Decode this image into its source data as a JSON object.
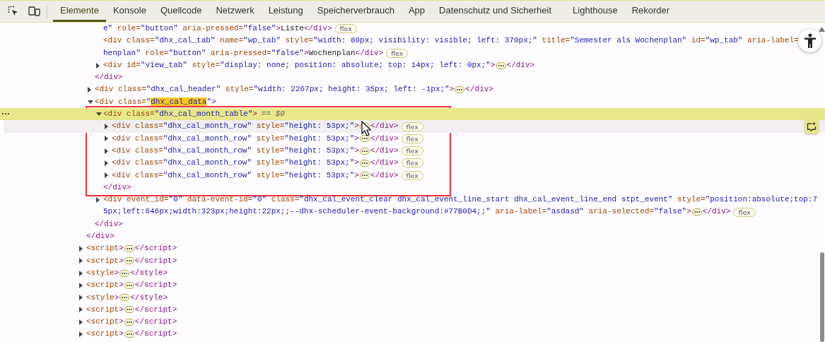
{
  "tabs": [
    {
      "label": "Elemente",
      "selected": true
    },
    {
      "label": "Konsole",
      "selected": false
    },
    {
      "label": "Quellcode",
      "selected": false
    },
    {
      "label": "Netzwerk",
      "selected": false
    },
    {
      "label": "Leistung",
      "selected": false
    },
    {
      "label": "Speicherverbrauch",
      "selected": false
    },
    {
      "label": "App",
      "selected": false
    },
    {
      "label": "Datenschutz und Sicherheit",
      "selected": false
    },
    {
      "label": "Lighthouse",
      "selected": false
    },
    {
      "label": "Rekorder",
      "selected": false
    }
  ],
  "dom": [
    {
      "close": "</div>",
      "children": [
        {
          "close": "</div>",
          "children": [
            {
              "lines": [
                "e\" role=\"button\" aria-pressed=\"false\">Liste</div>"
              ],
              "badge": "flex",
              "selected": false
            },
            {
              "lines": [
                "<div class=\"dhx_cal_tab\" name=\"wp_tab\" style=\"width: 80px; visibility: visible; left: 370px;\" title=\"Semester als Wochenplan\" id=\"wp_tab\" aria-label=",
                "henplan\" role=\"button\" aria-pressed=\"false\">Wochenplan</div>"
              ],
              "badge": "flex",
              "selected": false
            },
            {
              "lines": [
                "<div id=\"view_tab\" style=\"display: none; position: absolute; top: 14px; left: 0px;\">"
              ],
              "expanded": false,
              "close": "</div>",
              "selected": false
            }
          ]
        },
        {
          "lines": [
            "<div class=\"dhx_cal_header\" style=\"width: 2267px; height: 35px; left: -1px;\">"
          ],
          "expanded": false,
          "close": "</div>",
          "selected": false
        },
        {
          "lines": [
            [
              "<div class=\"",
              {
                "text": "dhx_cal_data",
                "highlight": true
              },
              "\">"
            ]
          ],
          "expanded": true,
          "close": "</div>",
          "selected": false,
          "children": [
            {
              "lines": [
                "<div class=\"dhx_cal_month_table\">"
              ],
              "expanded": true,
              "selected": true,
              "outlined": true,
              "suffix": "== *$0*",
              "close": "</div>",
              "children": [
                {
                  "lines": [
                    "<div class=\"dhx_cal_month_row\" style=\"height: 53px;\">"
                  ],
                  "expanded": false,
                  "close": "</div>",
                  "badge": "flex",
                  "selected": false,
                  "hovered": true
                },
                {
                  "lines": [
                    "<div class=\"dhx_cal_month_row\" style=\"height: 53px;\">"
                  ],
                  "expanded": false,
                  "close": "</div>",
                  "badge": "flex",
                  "selected": false,
                  "hovered": false
                },
                {
                  "lines": [
                    "<div class=\"dhx_cal_month_row\" style=\"height: 53px;\">"
                  ],
                  "expanded": false,
                  "close": "</div>",
                  "badge": "flex",
                  "selected": false,
                  "hovered": false
                },
                {
                  "lines": [
                    "<div class=\"dhx_cal_month_row\" style=\"height: 53px;\">"
                  ],
                  "expanded": false,
                  "close": "</div>",
                  "badge": "flex",
                  "selected": false,
                  "hovered": false
                },
                {
                  "lines": [
                    "<div class=\"dhx_cal_month_row\" style=\"height: 53px;\">"
                  ],
                  "expanded": false,
                  "close": "</div>",
                  "badge": "flex",
                  "selected": false,
                  "hovered": false
                }
              ]
            },
            {
              "lines": [
                "<div event_id=\"0\" data-event-id=\"0\" class=\"dhx_cal_event_clear dhx_cal_event_line_start dhx_cal_event_line_end stpt_event\" style=\"position:absolute;top:7",
                "5px;left:646px;width:323px;height:22px;;--dhx-scheduler-event-background:#77B0D4;;\" aria-label=\"asdasd\" aria-selected=\"false\">"
              ],
              "expanded": false,
              "close": "</div>",
              "badge": "flex",
              "selected": false
            }
          ]
        }
      ]
    },
    {
      "lines": [
        "<script>"
      ],
      "expanded": false,
      "close": "</script>",
      "selected": false
    },
    {
      "lines": [
        "<script>"
      ],
      "expanded": false,
      "close": "</script>",
      "selected": false
    },
    {
      "lines": [
        "<style>"
      ],
      "expanded": false,
      "close": "</style>",
      "selected": false
    },
    {
      "lines": [
        "<script>"
      ],
      "expanded": false,
      "close": "</script>",
      "selected": false
    },
    {
      "lines": [
        "<style>"
      ],
      "expanded": false,
      "close": "</style>",
      "selected": false
    },
    {
      "lines": [
        "<script>"
      ],
      "expanded": false,
      "close": "</script>",
      "selected": false
    },
    {
      "lines": [
        "<script>"
      ],
      "expanded": false,
      "close": "</script>",
      "selected": false
    },
    {
      "lines": [
        "<script>"
      ],
      "expanded": false,
      "close": "</script>",
      "selected": false
    }
  ]
}
